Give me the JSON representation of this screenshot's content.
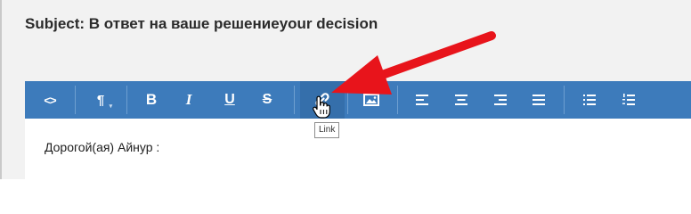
{
  "subject": "Subject: В ответ на ваше решениеyour decision",
  "toolbar": {
    "code_label": "<>",
    "paragraph_label": "¶",
    "paragraph_caret": "▾",
    "bold_label": "B",
    "italic_label": "I",
    "underline_label": "U",
    "strike_label": "S"
  },
  "tooltip": "Link",
  "editor": {
    "body_text": "Дорогой(ая) Айнур :"
  },
  "colors": {
    "toolbar": "#3d7bbb",
    "annotation_arrow": "#e8141b"
  }
}
